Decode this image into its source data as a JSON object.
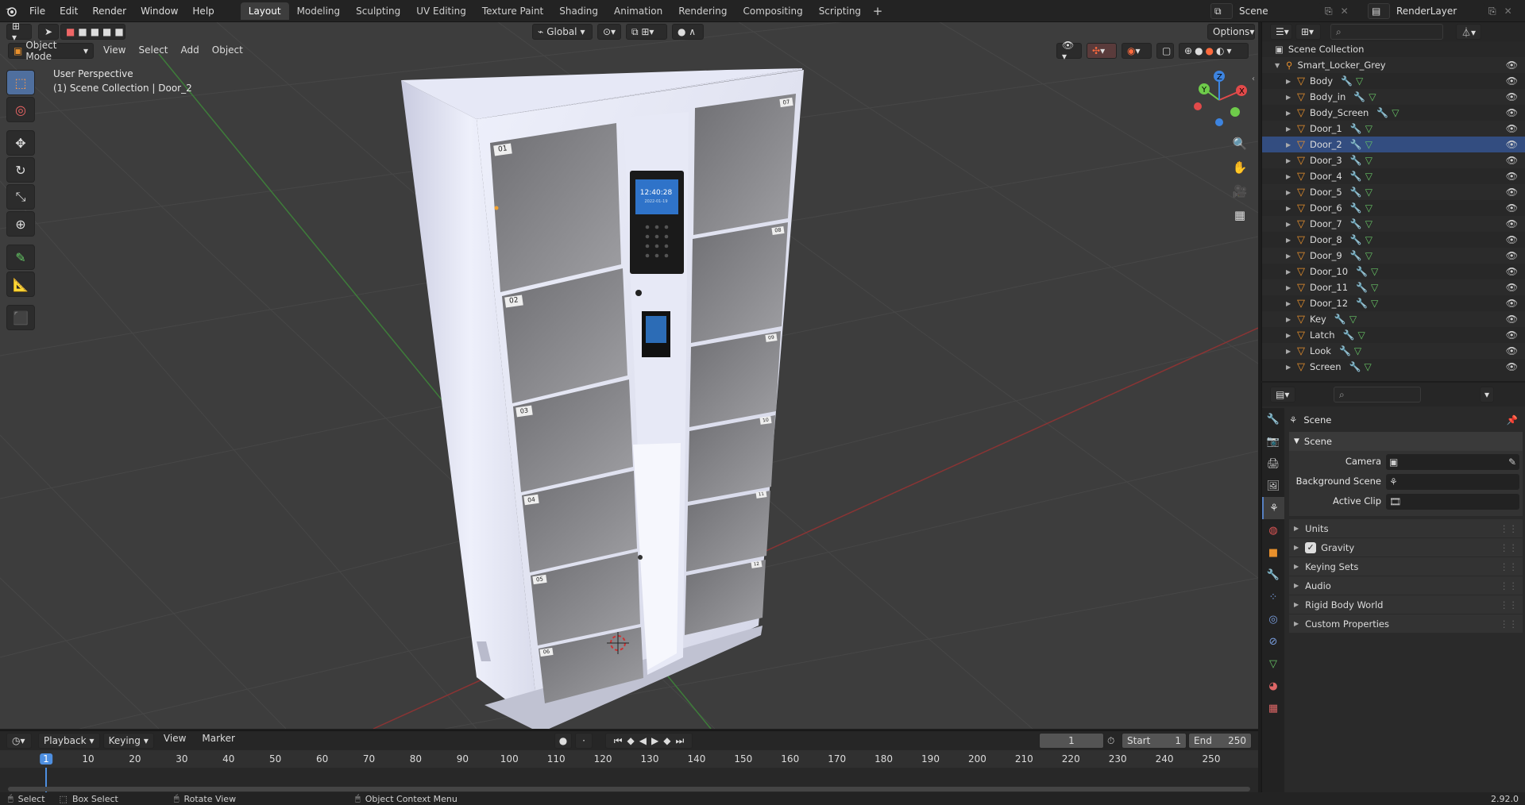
{
  "topbar": {
    "menus": [
      "File",
      "Edit",
      "Render",
      "Window",
      "Help"
    ],
    "workspaces": [
      "Layout",
      "Modeling",
      "Sculpting",
      "UV Editing",
      "Texture Paint",
      "Shading",
      "Animation",
      "Rendering",
      "Compositing",
      "Scripting"
    ],
    "active_workspace": "Layout",
    "scene_name": "Scene",
    "view_layer": "RenderLayer"
  },
  "viewport": {
    "mode": "Object Mode",
    "menus": [
      "View",
      "Select",
      "Add",
      "Object"
    ],
    "transform_orientation": "Global",
    "options_label": "Options",
    "perspective_label": "User Perspective",
    "context_label": "(1) Scene Collection | Door_2",
    "gizmo_axes": [
      "X",
      "Y",
      "Z"
    ],
    "locker_labels": {
      "left": [
        "01",
        "02",
        "03",
        "04",
        "05",
        "06"
      ],
      "right": [
        "07",
        "08",
        "09",
        "10",
        "11",
        "12"
      ]
    },
    "screen_time": "12:40:28",
    "screen_date": "2022-01-19"
  },
  "toolbar": {
    "tools": [
      "select-box",
      "cursor",
      "move",
      "rotate",
      "scale",
      "transform",
      "annotate",
      "measure",
      "add-cube"
    ]
  },
  "outliner": {
    "root": "Scene Collection",
    "collection": "Smart_Locker_Grey",
    "objects": [
      "Body",
      "Body_in",
      "Body_Screen",
      "Door_1",
      "Door_2",
      "Door_3",
      "Door_4",
      "Door_5",
      "Door_6",
      "Door_7",
      "Door_8",
      "Door_9",
      "Door_10",
      "Door_11",
      "Door_12",
      "Key",
      "Latch",
      "Look",
      "Screen"
    ],
    "active_object": "Door_2"
  },
  "properties": {
    "context_name": "Scene",
    "panel_title": "Scene",
    "fields": [
      {
        "label": "Camera"
      },
      {
        "label": "Background Scene"
      },
      {
        "label": "Active Clip"
      }
    ],
    "subpanels": [
      "Units",
      "Gravity",
      "Keying Sets",
      "Audio",
      "Rigid Body World",
      "Custom Properties"
    ],
    "gravity_checked": true
  },
  "timeline": {
    "menus": [
      "Playback",
      "Keying",
      "View",
      "Marker"
    ],
    "current_frame": "1",
    "start_label": "Start",
    "start": "1",
    "end_label": "End",
    "end": "250",
    "ticks": [
      "1",
      "10",
      "20",
      "30",
      "40",
      "50",
      "60",
      "70",
      "80",
      "90",
      "100",
      "110",
      "120",
      "130",
      "140",
      "150",
      "160",
      "170",
      "180",
      "190",
      "200",
      "210",
      "220",
      "230",
      "240",
      "250"
    ]
  },
  "statusbar": {
    "select": "Select",
    "box_select": "Box Select",
    "rotate_view": "Rotate View",
    "context_menu": "Object Context Menu",
    "version": "2.92.0"
  },
  "colors": {
    "active_blue": "#4f6f9e",
    "object_orange": "#e8902c",
    "mesh_green": "#67c365",
    "axis_x": "#e24a4a",
    "axis_y": "#6ecb4a",
    "axis_z": "#3d84e0"
  }
}
